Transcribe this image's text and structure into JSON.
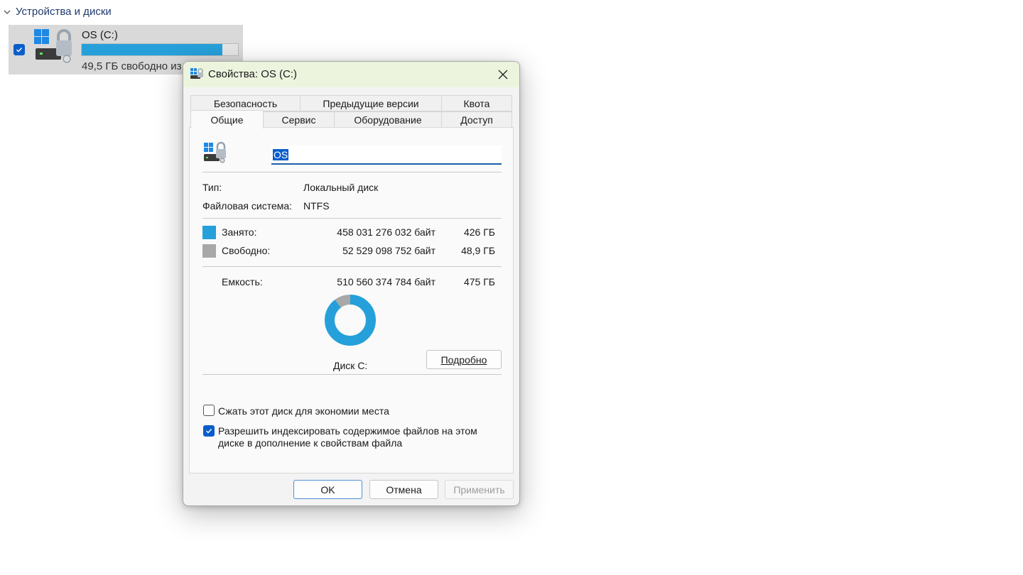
{
  "explorer": {
    "section_title": "Устройства и диски",
    "drive": {
      "name": "OS (C:)",
      "subtitle": "49,5 ГБ свободно из",
      "used_fraction": 0.9,
      "checked": true
    }
  },
  "dialog": {
    "title": "Свойства: OS (C:)",
    "tabs_row1": [
      "Безопасность",
      "Предыдущие версии",
      "Квота"
    ],
    "tabs_row2": [
      "Общие",
      "Сервис",
      "Оборудование",
      "Доступ"
    ],
    "active_tab": "Общие",
    "drive_name_value": "OS",
    "type_label": "Тип:",
    "type_value": "Локальный диск",
    "fs_label": "Файловая система:",
    "fs_value": "NTFS",
    "used_label": "Занято:",
    "used_bytes": "458 031 276 032 байт",
    "used_size": "426 ГБ",
    "free_label": "Свободно:",
    "free_bytes": "52 529 098 752 байт",
    "free_size": "48,9 ГБ",
    "capacity_label": "Емкость:",
    "capacity_bytes": "510 560 374 784 байт",
    "capacity_size": "475 ГБ",
    "disk_label": "Диск C:",
    "details_button": "Подробно",
    "compress_label": "Сжать этот диск для экономии места",
    "compress_checked": false,
    "index_label_line1": "Разрешить индексировать содержимое файлов на этом",
    "index_label_line2": "диске в дополнение к свойствам файла",
    "index_checked": true,
    "ok_button": "OK",
    "cancel_button": "Отмена",
    "apply_button": "Применить"
  },
  "chart_data": {
    "type": "pie",
    "categories": [
      "Занято",
      "Свободно"
    ],
    "values": [
      458031276032,
      52529098752
    ],
    "colors": [
      "#26a0da",
      "#a8a8a8"
    ],
    "style": "donut"
  },
  "colors": {
    "used": "#26a0da",
    "free": "#a8a8a8",
    "accent": "#0a5ecb",
    "titlebar": "#ecf4de"
  }
}
